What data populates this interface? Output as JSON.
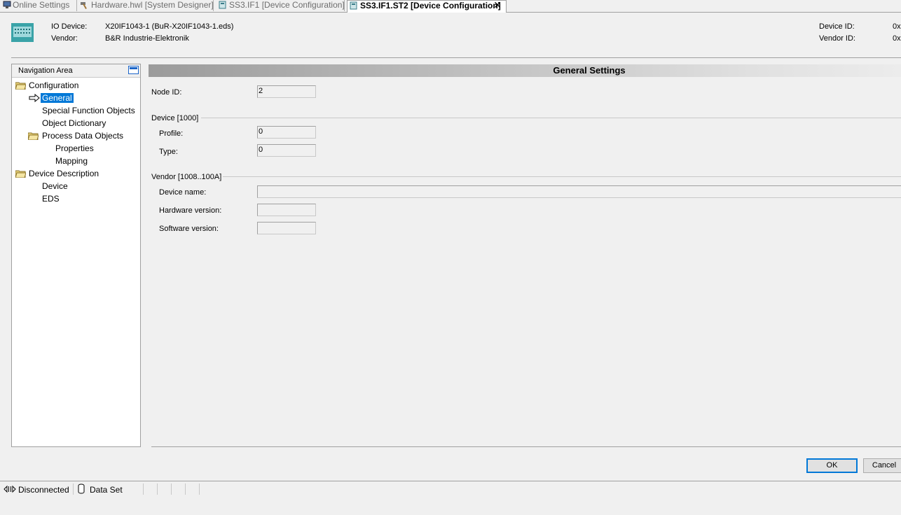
{
  "tabs": [
    {
      "label": "Online Settings",
      "icon": "monitor-icon",
      "active": false
    },
    {
      "label": "Hardware.hwl [System Designer]",
      "icon": "hammer-icon",
      "active": false
    },
    {
      "label": "SS3.IF1 [Device Configuration]",
      "icon": "device-icon",
      "active": false
    },
    {
      "label": "SS3.IF1.ST2 [Device Configuration]",
      "icon": "device-icon",
      "active": true
    }
  ],
  "header": {
    "io_device_label": "IO Device:",
    "io_device_value": "X20IF1043-1 (BuR-X20IF1043-1.eds)",
    "vendor_label": "Vendor:",
    "vendor_value": "B&R Industrie-Elektronik",
    "device_id_label": "Device ID:",
    "device_id_value": "0x",
    "vendor_id_label": "Vendor ID:",
    "vendor_id_value": "0x"
  },
  "nav": {
    "title": "Navigation Area",
    "items": [
      {
        "label": "Configuration"
      },
      {
        "label": "General"
      },
      {
        "label": "Special Function Objects"
      },
      {
        "label": "Object Dictionary"
      },
      {
        "label": "Process Data Objects"
      },
      {
        "label": "Properties"
      },
      {
        "label": "Mapping"
      },
      {
        "label": "Device Description"
      },
      {
        "label": "Device"
      },
      {
        "label": "EDS"
      }
    ]
  },
  "general": {
    "title": "General Settings",
    "node_id_label": "Node ID:",
    "node_id_value": "2",
    "device_group": "Device [1000]",
    "profile_label": "Profile:",
    "profile_value": "0",
    "type_label": "Type:",
    "type_value": "0",
    "vendor_group": "Vendor [1008..100A]",
    "device_name_label": "Device name:",
    "device_name_value": "",
    "hw_version_label": "Hardware version:",
    "hw_version_value": "",
    "sw_version_label": "Software version:",
    "sw_version_value": ""
  },
  "buttons": {
    "ok": "OK",
    "cancel": "Cancel"
  },
  "status": {
    "connection": "Disconnected",
    "dataset": "Data Set"
  },
  "colors": {
    "selection": "#0078d7",
    "panel_bg": "#f0f0f0"
  }
}
